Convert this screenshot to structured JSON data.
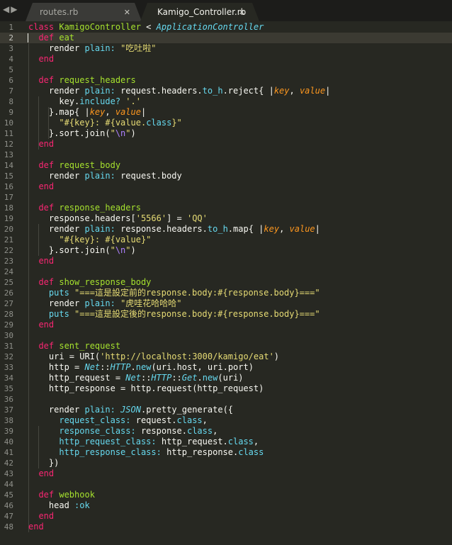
{
  "window": {
    "nav": {
      "back": "◀",
      "forward": "▶"
    },
    "tabs": [
      {
        "label": "routes.rb",
        "close": "✕",
        "active": false
      },
      {
        "label": "Kamigo_Controller.rb",
        "close": "✕",
        "active": true
      }
    ]
  },
  "editor": {
    "current_line": 2,
    "lines": [
      [
        [
          "k",
          "class "
        ],
        [
          "c",
          "KamigoController"
        ],
        [
          "t",
          " < "
        ],
        [
          "i",
          "ApplicationController"
        ]
      ],
      [
        [
          "t",
          "  "
        ],
        [
          "k",
          "def "
        ],
        [
          "c",
          "eat"
        ]
      ],
      [
        [
          "t",
          "    render "
        ],
        [
          "y",
          "plain: "
        ],
        [
          "s",
          "\"吃吐啦\""
        ]
      ],
      [
        [
          "t",
          "  "
        ],
        [
          "k",
          "end"
        ]
      ],
      [],
      [
        [
          "t",
          "  "
        ],
        [
          "k",
          "def "
        ],
        [
          "c",
          "request_headers"
        ]
      ],
      [
        [
          "t",
          "    render "
        ],
        [
          "y",
          "plain: "
        ],
        [
          "t",
          "request.headers."
        ],
        [
          "y",
          "to_h"
        ],
        [
          "t",
          ".reject{ |"
        ],
        [
          "p",
          "key"
        ],
        [
          "t",
          ", "
        ],
        [
          "p",
          "value"
        ],
        [
          "t",
          "|"
        ]
      ],
      [
        [
          "t",
          "      key."
        ],
        [
          "y",
          "include?"
        ],
        [
          "t",
          " "
        ],
        [
          "s",
          "'.'"
        ]
      ],
      [
        [
          "t",
          "    }.map{ |"
        ],
        [
          "p",
          "key"
        ],
        [
          "t",
          ", "
        ],
        [
          "p",
          "value"
        ],
        [
          "t",
          "|"
        ]
      ],
      [
        [
          "t",
          "      "
        ],
        [
          "s",
          "\"#{key}: #{value."
        ],
        [
          "y",
          "class"
        ],
        [
          "s",
          "}\""
        ]
      ],
      [
        [
          "t",
          "    }.sort.join("
        ],
        [
          "s",
          "\""
        ],
        [
          "n",
          "\\n"
        ],
        [
          "s",
          "\""
        ],
        [
          "t",
          ")"
        ]
      ],
      [
        [
          "t",
          "  "
        ],
        [
          "k",
          "end"
        ]
      ],
      [],
      [
        [
          "t",
          "  "
        ],
        [
          "k",
          "def "
        ],
        [
          "c",
          "request_body"
        ]
      ],
      [
        [
          "t",
          "    render "
        ],
        [
          "y",
          "plain: "
        ],
        [
          "t",
          "request.body"
        ]
      ],
      [
        [
          "t",
          "  "
        ],
        [
          "k",
          "end"
        ]
      ],
      [],
      [
        [
          "t",
          "  "
        ],
        [
          "k",
          "def "
        ],
        [
          "c",
          "response_headers"
        ]
      ],
      [
        [
          "t",
          "    response.headers["
        ],
        [
          "s",
          "'5566'"
        ],
        [
          "t",
          "] = "
        ],
        [
          "s",
          "'QQ'"
        ]
      ],
      [
        [
          "t",
          "    render "
        ],
        [
          "y",
          "plain: "
        ],
        [
          "t",
          "response.headers."
        ],
        [
          "y",
          "to_h"
        ],
        [
          "t",
          ".map{ |"
        ],
        [
          "p",
          "key"
        ],
        [
          "t",
          ", "
        ],
        [
          "p",
          "value"
        ],
        [
          "t",
          "|"
        ]
      ],
      [
        [
          "t",
          "      "
        ],
        [
          "s",
          "\"#{key}: #{value}\""
        ]
      ],
      [
        [
          "t",
          "    }.sort.join("
        ],
        [
          "s",
          "\""
        ],
        [
          "n",
          "\\n"
        ],
        [
          "s",
          "\""
        ],
        [
          "t",
          ")"
        ]
      ],
      [
        [
          "t",
          "  "
        ],
        [
          "k",
          "end"
        ]
      ],
      [],
      [
        [
          "t",
          "  "
        ],
        [
          "k",
          "def "
        ],
        [
          "c",
          "show_response_body"
        ]
      ],
      [
        [
          "t",
          "    "
        ],
        [
          "y",
          "puts"
        ],
        [
          "t",
          " "
        ],
        [
          "s",
          "\"===這是設定前的response.body:#{response.body}===\""
        ]
      ],
      [
        [
          "t",
          "    render "
        ],
        [
          "y",
          "plain: "
        ],
        [
          "s",
          "\"虎哇花哈哈哈\""
        ]
      ],
      [
        [
          "t",
          "    "
        ],
        [
          "y",
          "puts"
        ],
        [
          "t",
          " "
        ],
        [
          "s",
          "\"===這是設定後的response.body:#{response.body}===\""
        ]
      ],
      [
        [
          "t",
          "  "
        ],
        [
          "k",
          "end"
        ]
      ],
      [],
      [
        [
          "t",
          "  "
        ],
        [
          "k",
          "def "
        ],
        [
          "c",
          "sent_request"
        ]
      ],
      [
        [
          "t",
          "    uri = URI("
        ],
        [
          "s",
          "'http://localhost:3000/kamigo/eat'"
        ],
        [
          "t",
          ")"
        ]
      ],
      [
        [
          "t",
          "    http = "
        ],
        [
          "i",
          "Net"
        ],
        [
          "t",
          "::"
        ],
        [
          "i",
          "HTTP"
        ],
        [
          "t",
          "."
        ],
        [
          "y",
          "new"
        ],
        [
          "t",
          "(uri.host, uri.port)"
        ]
      ],
      [
        [
          "t",
          "    http_request = "
        ],
        [
          "i",
          "Net"
        ],
        [
          "t",
          "::"
        ],
        [
          "i",
          "HTTP"
        ],
        [
          "t",
          "::"
        ],
        [
          "i",
          "Get"
        ],
        [
          "t",
          "."
        ],
        [
          "y",
          "new"
        ],
        [
          "t",
          "(uri)"
        ]
      ],
      [
        [
          "t",
          "    http_response = http.request(http_request)"
        ]
      ],
      [],
      [
        [
          "t",
          "    render "
        ],
        [
          "y",
          "plain: "
        ],
        [
          "i",
          "JSON"
        ],
        [
          "t",
          ".pretty_generate({"
        ]
      ],
      [
        [
          "t",
          "      "
        ],
        [
          "y",
          "request_class: "
        ],
        [
          "t",
          "request."
        ],
        [
          "y",
          "class"
        ],
        [
          "t",
          ","
        ]
      ],
      [
        [
          "t",
          "      "
        ],
        [
          "y",
          "response_class: "
        ],
        [
          "t",
          "response."
        ],
        [
          "y",
          "class"
        ],
        [
          "t",
          ","
        ]
      ],
      [
        [
          "t",
          "      "
        ],
        [
          "y",
          "http_request_class: "
        ],
        [
          "t",
          "http_request."
        ],
        [
          "y",
          "class"
        ],
        [
          "t",
          ","
        ]
      ],
      [
        [
          "t",
          "      "
        ],
        [
          "y",
          "http_response_class: "
        ],
        [
          "t",
          "http_response."
        ],
        [
          "y",
          "class"
        ]
      ],
      [
        [
          "t",
          "    })"
        ]
      ],
      [
        [
          "t",
          "  "
        ],
        [
          "k",
          "end"
        ]
      ],
      [],
      [
        [
          "t",
          "  "
        ],
        [
          "k",
          "def "
        ],
        [
          "c",
          "webhook"
        ]
      ],
      [
        [
          "t",
          "    head "
        ],
        [
          "y",
          ":ok"
        ]
      ],
      [
        [
          "t",
          "  "
        ],
        [
          "k",
          "end"
        ]
      ],
      [
        [
          "k",
          "end"
        ]
      ]
    ]
  }
}
